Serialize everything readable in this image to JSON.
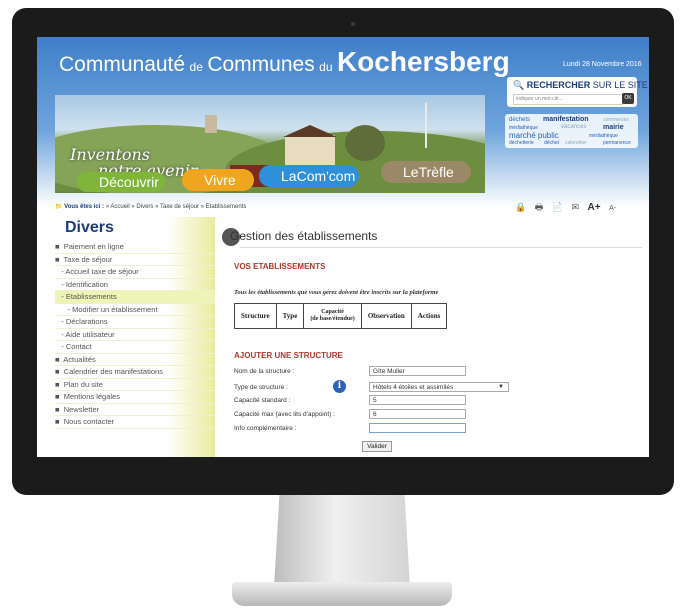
{
  "site": {
    "brand": {
      "w1": "Communauté",
      "s1": "de",
      "w2": "Communes",
      "s2": "du",
      "big": "Kochersberg"
    },
    "date": "Lundi 28 Novembre 2016",
    "slogan": {
      "line1": "Inventons",
      "line2": "notre avenir"
    },
    "search": {
      "label": "RECHERCHER",
      "label_suffix": " SUR LE SITE",
      "placeholder": "indiquer un mot-clé...",
      "button": "OK"
    },
    "tags": [
      "déchets",
      "manifestation",
      "commerces",
      "médiathèque",
      "vacances",
      "mairie",
      "marché public",
      "médiathèque",
      "déchetterie",
      "déchet",
      "calendrier",
      "permanence"
    ],
    "nav": [
      {
        "pre": "Déc",
        "post": "ouvrir",
        "color": "#7fb53a"
      },
      {
        "pre": "Viv",
        "post": "re",
        "color": "#f0a51e"
      },
      {
        "pre": "La",
        "post": "Com'com",
        "color": "#2f8fd8"
      },
      {
        "pre": "Le",
        "post": "Trèfle",
        "color": "#9b8866"
      }
    ]
  },
  "breadcrumb": {
    "label": "Vous êtes ici :",
    "path": " » Accueil » Divers » Taxe de séjour » Etablissements"
  },
  "toolbar": {
    "tools": [
      "lock-icon",
      "print-icon",
      "pdf-icon",
      "mail-icon"
    ],
    "font_plus": "A+",
    "font_minus": "A-"
  },
  "sidebar": {
    "title": "Divers",
    "items": [
      {
        "label": "■  Paiement en ligne"
      },
      {
        "label": "■  Taxe de séjour"
      },
      {
        "label": "   - Accueil taxe de séjour"
      },
      {
        "label": "   - Identification"
      },
      {
        "label": "   - Etablissements",
        "active": true
      },
      {
        "label": "      - Modifier un établissement"
      },
      {
        "label": "   - Déclarations"
      },
      {
        "label": "   - Aide utilisateur"
      },
      {
        "label": "   - Contact"
      },
      {
        "label": "■  Actualités"
      },
      {
        "label": "■  Calendrier des manifestations"
      },
      {
        "label": "■  Plan du site"
      },
      {
        "label": "■  Mentions légales"
      },
      {
        "label": "■  Newsletter"
      },
      {
        "label": "■  Nous contacter"
      }
    ]
  },
  "main": {
    "title": "Gestion des établissements",
    "section1": "VOS ETABLISSEMENTS",
    "intro": "Tous les établissements que vous gérez doivent être inscrits sur la plateforme",
    "table_headers": [
      "Structure",
      "Type",
      "Capacité\n(de base/étendue)",
      "Observation",
      "Actions"
    ],
    "section2": "AJOUTER UNE STRUCTURE",
    "form": {
      "name_label": "Nom de la structure :",
      "name_value": "Gîte Muller",
      "type_label": "Type de structure :",
      "type_value": "Hôtels 4 étoiles et assimilés",
      "cap_std_label": "Capacité standard :",
      "cap_std_value": "5",
      "cap_max_label": "Capacité max (avec lits d'appoint) :",
      "cap_max_value": "6",
      "info_label": "Info complémentaire :",
      "info_value": "",
      "submit": "Valider"
    }
  }
}
